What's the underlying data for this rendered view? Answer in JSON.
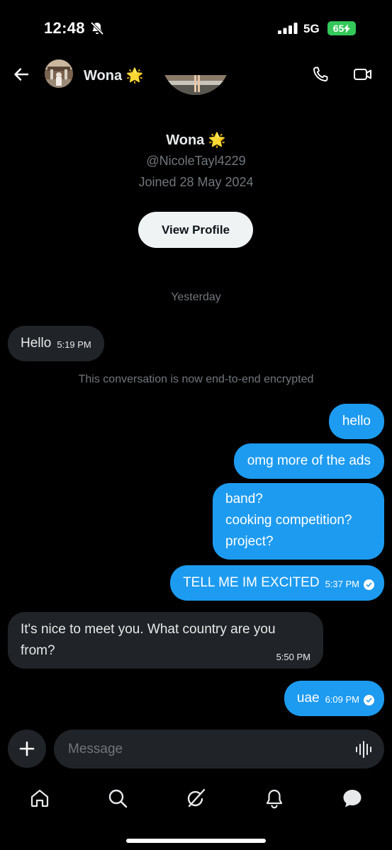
{
  "status_bar": {
    "time": "12:48",
    "network": "5G",
    "battery": "65"
  },
  "header": {
    "name": "Wona 🌟"
  },
  "profile": {
    "name": "Wona 🌟",
    "handle": "@NicoleTayl4229",
    "joined": "Joined 28 May 2024",
    "view_profile_label": "View Profile"
  },
  "day_separator": "Yesterday",
  "encryption_note": "This conversation is now end-to-end encrypted",
  "messages": [
    {
      "direction": "in",
      "text": "Hello",
      "time": "5:19 PM"
    },
    {
      "direction": "out",
      "text": "hello"
    },
    {
      "direction": "out",
      "text": "omg more of the ads"
    },
    {
      "direction": "out",
      "lines": [
        "band?",
        "cooking competition?",
        "project?"
      ]
    },
    {
      "direction": "out",
      "text": "TELL ME IM EXCITED",
      "time": "5:37 PM",
      "read": true
    },
    {
      "direction": "in",
      "lines": [
        "It's nice to meet you. What country are you",
        "from?"
      ],
      "time": "5:50 PM"
    },
    {
      "direction": "out",
      "text": "uae",
      "time": "6:09 PM",
      "read": true
    }
  ],
  "composer": {
    "placeholder": "Message"
  },
  "nav": {
    "icons": [
      "home-icon",
      "search-icon",
      "grok-icon",
      "notifications-icon",
      "messages-icon"
    ]
  },
  "colors": {
    "accent": "#1d9bf0",
    "incoming_bubble": "#202327",
    "background": "#000000",
    "battery": "#34c759"
  }
}
